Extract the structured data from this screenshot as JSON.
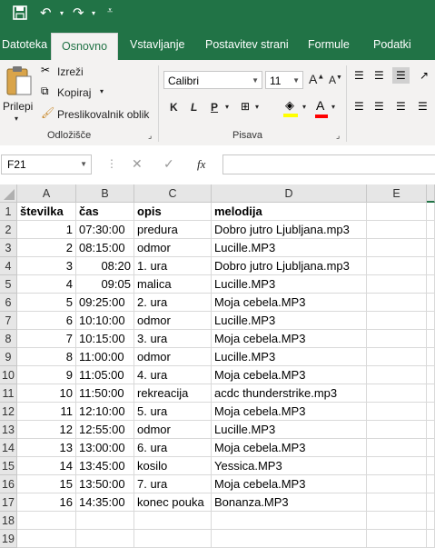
{
  "quick_access": {
    "save_icon": "save-icon",
    "undo_icon": "undo-icon",
    "redo_icon": "redo-icon",
    "customize_icon": "customize-icon"
  },
  "tabs": [
    "Datoteka",
    "Osnovno",
    "Vstavljanje",
    "Postavitev strani",
    "Formule",
    "Podatki"
  ],
  "active_tab": "Osnovno",
  "ribbon": {
    "paste_label": "Prilepi",
    "cut_label": "Izreži",
    "copy_label": "Kopiraj",
    "format_painter_label": "Preslikovalnik oblik",
    "clipboard_group": "Odložišče",
    "font_name": "Calibri",
    "font_size": "11",
    "bold": "K",
    "italic": "L",
    "underline": "P",
    "font_group": "Pisava",
    "grow_font": "A",
    "shrink_font": "A",
    "highlight_color": "#ffff00",
    "font_color": "#ff0000"
  },
  "formula_bar": {
    "name_box": "F21",
    "fx": "fx",
    "formula": ""
  },
  "columns": [
    "A",
    "B",
    "C",
    "D",
    "E"
  ],
  "rows": [
    {
      "n": "1",
      "a": "številka",
      "b": "čas",
      "c": "opis",
      "d": "melodija"
    },
    {
      "n": "2",
      "a": "1",
      "b": "07:30:00",
      "c": "predura",
      "d": "Dobro jutro Ljubljana.mp3"
    },
    {
      "n": "3",
      "a": "2",
      "b": "08:15:00",
      "c": "odmor",
      "d": "Lucille.MP3"
    },
    {
      "n": "4",
      "a": "3",
      "b": "08:20",
      "c": "1. ura",
      "d": "Dobro jutro Ljubljana.mp3"
    },
    {
      "n": "5",
      "a": "4",
      "b": "09:05",
      "c": "malica",
      "d": "Lucille.MP3"
    },
    {
      "n": "6",
      "a": "5",
      "b": "09:25:00",
      "c": "2. ura",
      "d": "Moja cebela.MP3"
    },
    {
      "n": "7",
      "a": "6",
      "b": "10:10:00",
      "c": "odmor",
      "d": "Lucille.MP3"
    },
    {
      "n": "8",
      "a": "7",
      "b": "10:15:00",
      "c": "3. ura",
      "d": "Moja cebela.MP3"
    },
    {
      "n": "9",
      "a": "8",
      "b": "11:00:00",
      "c": "odmor",
      "d": "Lucille.MP3"
    },
    {
      "n": "10",
      "a": "9",
      "b": "11:05:00",
      "c": "4. ura",
      "d": "Moja cebela.MP3"
    },
    {
      "n": "11",
      "a": "10",
      "b": "11:50:00",
      "c": "rekreacija",
      "d": "acdc thunderstrike.mp3"
    },
    {
      "n": "12",
      "a": "11",
      "b": "12:10:00",
      "c": "5. ura",
      "d": "Moja cebela.MP3"
    },
    {
      "n": "13",
      "a": "12",
      "b": "12:55:00",
      "c": "odmor",
      "d": "Lucille.MP3"
    },
    {
      "n": "14",
      "a": "13",
      "b": "13:00:00",
      "c": "6. ura",
      "d": "Moja cebela.MP3"
    },
    {
      "n": "15",
      "a": "14",
      "b": "13:45:00",
      "c": "kosilo",
      "d": "Yessica.MP3"
    },
    {
      "n": "16",
      "a": "15",
      "b": "13:50:00",
      "c": "7. ura",
      "d": "Moja cebela.MP3"
    },
    {
      "n": "17",
      "a": "16",
      "b": "14:35:00",
      "c": "konec pouka",
      "d": "Bonanza.MP3"
    },
    {
      "n": "18",
      "a": "",
      "b": "",
      "c": "",
      "d": ""
    },
    {
      "n": "19",
      "a": "",
      "b": "",
      "c": "",
      "d": ""
    }
  ],
  "colors": {
    "accent": "#217346",
    "ribbon_bg": "#f3f2f1",
    "header_bg": "#e6e6e6"
  }
}
